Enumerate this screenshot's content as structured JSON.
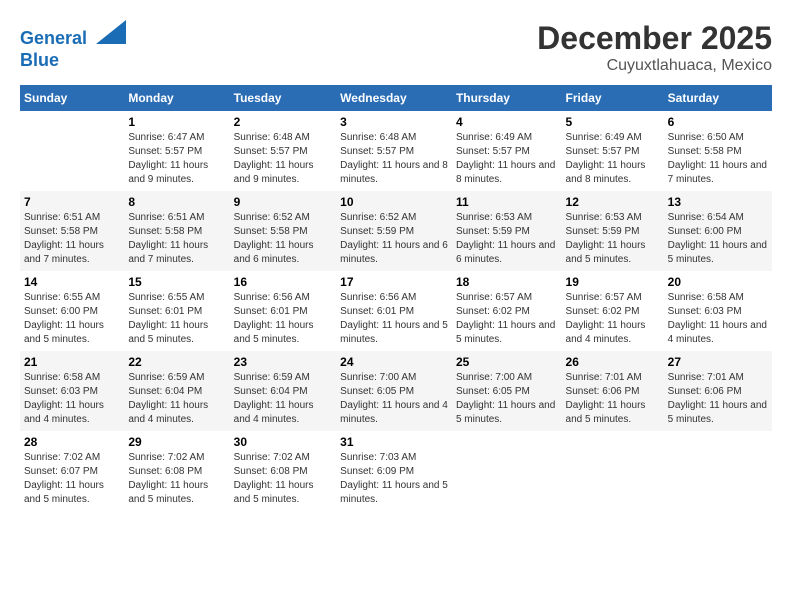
{
  "header": {
    "logo_line1": "General",
    "logo_line2": "Blue",
    "month": "December 2025",
    "location": "Cuyuxtlahuaca, Mexico"
  },
  "days_of_week": [
    "Sunday",
    "Monday",
    "Tuesday",
    "Wednesday",
    "Thursday",
    "Friday",
    "Saturday"
  ],
  "weeks": [
    [
      {
        "day": "",
        "sunrise": "",
        "sunset": "",
        "daylight": ""
      },
      {
        "day": "1",
        "sunrise": "Sunrise: 6:47 AM",
        "sunset": "Sunset: 5:57 PM",
        "daylight": "Daylight: 11 hours and 9 minutes."
      },
      {
        "day": "2",
        "sunrise": "Sunrise: 6:48 AM",
        "sunset": "Sunset: 5:57 PM",
        "daylight": "Daylight: 11 hours and 9 minutes."
      },
      {
        "day": "3",
        "sunrise": "Sunrise: 6:48 AM",
        "sunset": "Sunset: 5:57 PM",
        "daylight": "Daylight: 11 hours and 8 minutes."
      },
      {
        "day": "4",
        "sunrise": "Sunrise: 6:49 AM",
        "sunset": "Sunset: 5:57 PM",
        "daylight": "Daylight: 11 hours and 8 minutes."
      },
      {
        "day": "5",
        "sunrise": "Sunrise: 6:49 AM",
        "sunset": "Sunset: 5:57 PM",
        "daylight": "Daylight: 11 hours and 8 minutes."
      },
      {
        "day": "6",
        "sunrise": "Sunrise: 6:50 AM",
        "sunset": "Sunset: 5:58 PM",
        "daylight": "Daylight: 11 hours and 7 minutes."
      }
    ],
    [
      {
        "day": "7",
        "sunrise": "Sunrise: 6:51 AM",
        "sunset": "Sunset: 5:58 PM",
        "daylight": "Daylight: 11 hours and 7 minutes."
      },
      {
        "day": "8",
        "sunrise": "Sunrise: 6:51 AM",
        "sunset": "Sunset: 5:58 PM",
        "daylight": "Daylight: 11 hours and 7 minutes."
      },
      {
        "day": "9",
        "sunrise": "Sunrise: 6:52 AM",
        "sunset": "Sunset: 5:58 PM",
        "daylight": "Daylight: 11 hours and 6 minutes."
      },
      {
        "day": "10",
        "sunrise": "Sunrise: 6:52 AM",
        "sunset": "Sunset: 5:59 PM",
        "daylight": "Daylight: 11 hours and 6 minutes."
      },
      {
        "day": "11",
        "sunrise": "Sunrise: 6:53 AM",
        "sunset": "Sunset: 5:59 PM",
        "daylight": "Daylight: 11 hours and 6 minutes."
      },
      {
        "day": "12",
        "sunrise": "Sunrise: 6:53 AM",
        "sunset": "Sunset: 5:59 PM",
        "daylight": "Daylight: 11 hours and 5 minutes."
      },
      {
        "day": "13",
        "sunrise": "Sunrise: 6:54 AM",
        "sunset": "Sunset: 6:00 PM",
        "daylight": "Daylight: 11 hours and 5 minutes."
      }
    ],
    [
      {
        "day": "14",
        "sunrise": "Sunrise: 6:55 AM",
        "sunset": "Sunset: 6:00 PM",
        "daylight": "Daylight: 11 hours and 5 minutes."
      },
      {
        "day": "15",
        "sunrise": "Sunrise: 6:55 AM",
        "sunset": "Sunset: 6:01 PM",
        "daylight": "Daylight: 11 hours and 5 minutes."
      },
      {
        "day": "16",
        "sunrise": "Sunrise: 6:56 AM",
        "sunset": "Sunset: 6:01 PM",
        "daylight": "Daylight: 11 hours and 5 minutes."
      },
      {
        "day": "17",
        "sunrise": "Sunrise: 6:56 AM",
        "sunset": "Sunset: 6:01 PM",
        "daylight": "Daylight: 11 hours and 5 minutes."
      },
      {
        "day": "18",
        "sunrise": "Sunrise: 6:57 AM",
        "sunset": "Sunset: 6:02 PM",
        "daylight": "Daylight: 11 hours and 5 minutes."
      },
      {
        "day": "19",
        "sunrise": "Sunrise: 6:57 AM",
        "sunset": "Sunset: 6:02 PM",
        "daylight": "Daylight: 11 hours and 4 minutes."
      },
      {
        "day": "20",
        "sunrise": "Sunrise: 6:58 AM",
        "sunset": "Sunset: 6:03 PM",
        "daylight": "Daylight: 11 hours and 4 minutes."
      }
    ],
    [
      {
        "day": "21",
        "sunrise": "Sunrise: 6:58 AM",
        "sunset": "Sunset: 6:03 PM",
        "daylight": "Daylight: 11 hours and 4 minutes."
      },
      {
        "day": "22",
        "sunrise": "Sunrise: 6:59 AM",
        "sunset": "Sunset: 6:04 PM",
        "daylight": "Daylight: 11 hours and 4 minutes."
      },
      {
        "day": "23",
        "sunrise": "Sunrise: 6:59 AM",
        "sunset": "Sunset: 6:04 PM",
        "daylight": "Daylight: 11 hours and 4 minutes."
      },
      {
        "day": "24",
        "sunrise": "Sunrise: 7:00 AM",
        "sunset": "Sunset: 6:05 PM",
        "daylight": "Daylight: 11 hours and 4 minutes."
      },
      {
        "day": "25",
        "sunrise": "Sunrise: 7:00 AM",
        "sunset": "Sunset: 6:05 PM",
        "daylight": "Daylight: 11 hours and 5 minutes."
      },
      {
        "day": "26",
        "sunrise": "Sunrise: 7:01 AM",
        "sunset": "Sunset: 6:06 PM",
        "daylight": "Daylight: 11 hours and 5 minutes."
      },
      {
        "day": "27",
        "sunrise": "Sunrise: 7:01 AM",
        "sunset": "Sunset: 6:06 PM",
        "daylight": "Daylight: 11 hours and 5 minutes."
      }
    ],
    [
      {
        "day": "28",
        "sunrise": "Sunrise: 7:02 AM",
        "sunset": "Sunset: 6:07 PM",
        "daylight": "Daylight: 11 hours and 5 minutes."
      },
      {
        "day": "29",
        "sunrise": "Sunrise: 7:02 AM",
        "sunset": "Sunset: 6:08 PM",
        "daylight": "Daylight: 11 hours and 5 minutes."
      },
      {
        "day": "30",
        "sunrise": "Sunrise: 7:02 AM",
        "sunset": "Sunset: 6:08 PM",
        "daylight": "Daylight: 11 hours and 5 minutes."
      },
      {
        "day": "31",
        "sunrise": "Sunrise: 7:03 AM",
        "sunset": "Sunset: 6:09 PM",
        "daylight": "Daylight: 11 hours and 5 minutes."
      },
      {
        "day": "",
        "sunrise": "",
        "sunset": "",
        "daylight": ""
      },
      {
        "day": "",
        "sunrise": "",
        "sunset": "",
        "daylight": ""
      },
      {
        "day": "",
        "sunrise": "",
        "sunset": "",
        "daylight": ""
      }
    ]
  ]
}
